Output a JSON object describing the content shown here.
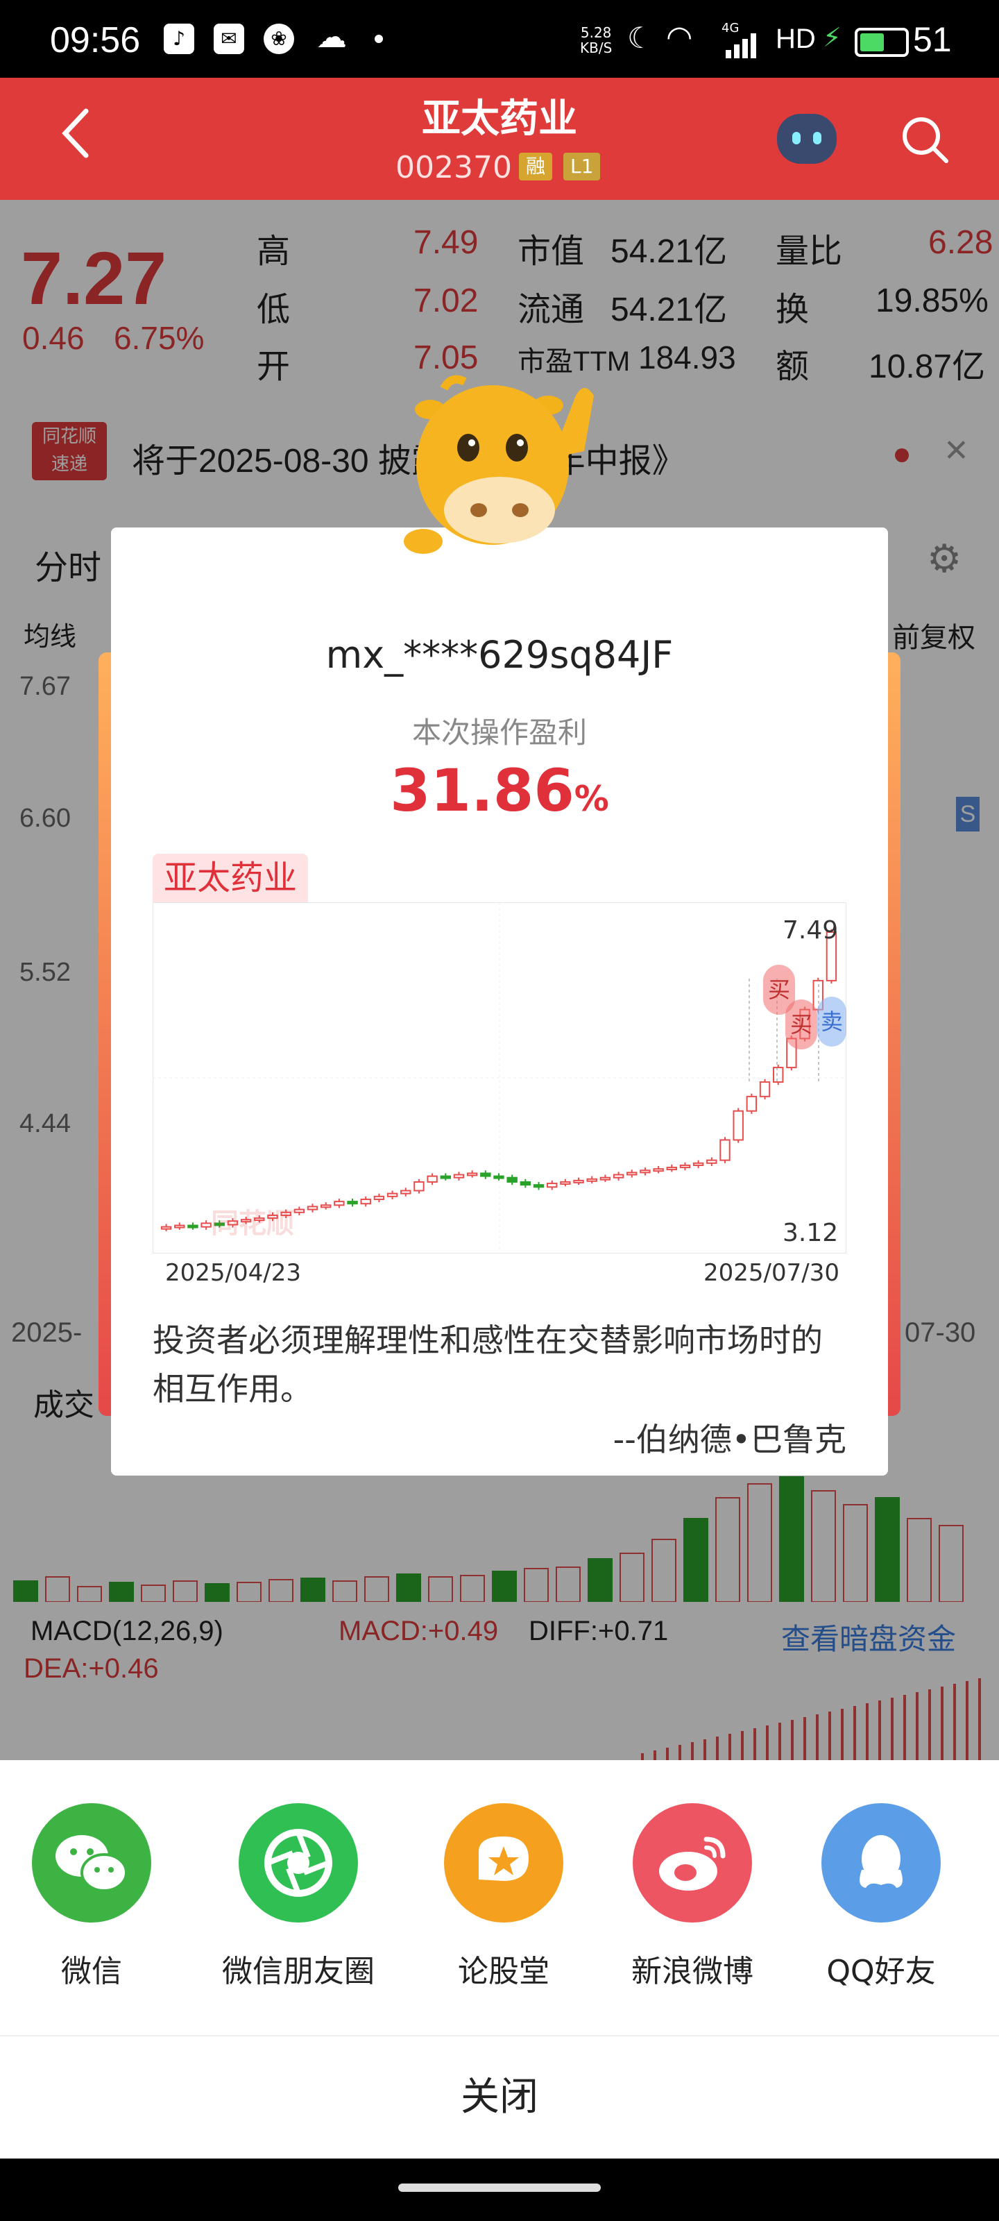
{
  "status": {
    "time": "09:56",
    "net_speed_value": "5.28",
    "net_speed_unit": "KB/S",
    "network": "4G",
    "hd": "HD",
    "battery": "51"
  },
  "header": {
    "title": "亚太药业",
    "code": "002370",
    "badge1": "融",
    "badge2": "L1"
  },
  "quote": {
    "price": "7.27",
    "change": "0.46",
    "change_pct": "6.75%",
    "high_label": "高",
    "high": "7.49",
    "low_label": "低",
    "low": "7.02",
    "open_label": "开",
    "open": "7.05",
    "mcap_label": "市值",
    "mcap": "54.21亿",
    "float_label": "流通",
    "float": "54.21亿",
    "pe_label": "市盈TTM",
    "pe": "184.93",
    "vr_label": "量比",
    "vr": "6.28",
    "turn_label": "换",
    "turn": "19.85%",
    "amount_label": "额",
    "amount": "10.87亿"
  },
  "notice": {
    "logo_top": "同花顺",
    "logo_bottom": "速递",
    "text": "将于2025-08-30 披露《2025年中报》"
  },
  "background": {
    "tab_time": "分时",
    "indicator": "均线",
    "fq": "前复权",
    "price_levels": [
      "7.67",
      "6.60",
      "5.52",
      "4.44"
    ],
    "date_left": "2025-",
    "date_right": "07-30",
    "volume_label": "成交",
    "macd_label": "MACD(12,26,9)",
    "macd": "MACD:+0.49",
    "diff": "DIFF:+0.71",
    "dea": "DEA:+0.46",
    "dark_pool": "查看暗盘资金",
    "s_marker": "S"
  },
  "card": {
    "username": "mx_****629sq84JF",
    "profit_label": "本次操作盈利",
    "profit_value": "31.86",
    "profit_unit": "%",
    "stock_tag": "亚太药业",
    "chart_high": "7.49",
    "chart_low": "3.12",
    "date_start": "2025/04/23",
    "date_end": "2025/07/30",
    "buy_marker": "买",
    "sell_marker": "卖",
    "watermark": "同花顺",
    "quote_text": "投资者必须理解理性和感性在交替影响市场时的相互作用。",
    "quote_author": "--伯纳德•巴鲁克"
  },
  "chart_data": {
    "type": "candlestick",
    "x_range": [
      "2025/04/23",
      "2025/07/30"
    ],
    "ylim": [
      3.12,
      7.49
    ],
    "annotations": [
      "7.49",
      "3.12"
    ],
    "markers": [
      {
        "label": "买"
      },
      {
        "label": "卖"
      }
    ],
    "closes_approx": [
      3.2,
      3.22,
      3.2,
      3.25,
      3.23,
      3.28,
      3.3,
      3.32,
      3.36,
      3.4,
      3.44,
      3.48,
      3.5,
      3.55,
      3.52,
      3.58,
      3.62,
      3.66,
      3.7,
      3.82,
      3.9,
      3.88,
      3.92,
      3.94,
      3.9,
      3.88,
      3.82,
      3.78,
      3.75,
      3.8,
      3.82,
      3.84,
      3.86,
      3.88,
      3.92,
      3.95,
      3.98,
      4.0,
      4.02,
      4.05,
      4.08,
      4.12,
      4.4,
      4.8,
      5.0,
      5.2,
      5.4,
      5.8,
      6.2,
      6.6,
      7.27
    ]
  },
  "share": {
    "items": [
      {
        "label": "微信",
        "color": "#3db343"
      },
      {
        "label": "微信朋友圈",
        "color": "#2fbf52"
      },
      {
        "label": "论股堂",
        "color": "#f5a11f"
      },
      {
        "label": "新浪微博",
        "color": "#ee5562"
      },
      {
        "label": "QQ好友",
        "color": "#5b9de6"
      }
    ],
    "close_label": "关闭"
  },
  "colors": {
    "accent_red": "#e03b3b",
    "profit_red": "#e0303a",
    "up": "#e84d4d",
    "down": "#2aa32a"
  }
}
